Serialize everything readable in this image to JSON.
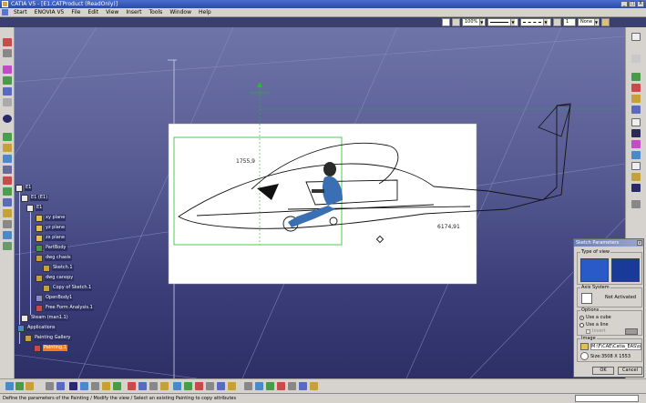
{
  "window": {
    "title": "CATIA V5 - [E1.CATProduct (ReadOnly)]",
    "controls": [
      "_",
      "□",
      "X"
    ]
  },
  "menu": [
    "Start",
    "ENOVIA V5",
    "File",
    "Edit",
    "View",
    "Insert",
    "Tools",
    "Window",
    "Help"
  ],
  "toolbar": {
    "zoom_value": "100%",
    "line_type_value": "",
    "line_weight_value": "",
    "layer_value": "1",
    "none_value": "None"
  },
  "dimensions": [
    "1755,9",
    "6174,91"
  ],
  "tree": {
    "nodes": [
      {
        "label": "E1",
        "selected": false
      },
      {
        "label": "E1 (E1)",
        "selected": false
      },
      {
        "label": "E1",
        "selected": false
      },
      {
        "label": "xy plane",
        "selected": false
      },
      {
        "label": "yz plane",
        "selected": false
      },
      {
        "label": "zx plane",
        "selected": false
      },
      {
        "label": "PartBody",
        "selected": false
      },
      {
        "label": "dwg chasis",
        "selected": false
      },
      {
        "label": "Sketch.1",
        "selected": false
      },
      {
        "label": "dwg canopy",
        "selected": false
      },
      {
        "label": "Copy of Sketch.1",
        "selected": false
      },
      {
        "label": "OpenBody1",
        "selected": false
      },
      {
        "label": "Free Form Analysis.1",
        "selected": false
      },
      {
        "label": "Steam (man1.1)",
        "selected": false
      },
      {
        "label": "Applications",
        "selected": false
      },
      {
        "label": "Painting Gallery",
        "selected": false
      },
      {
        "label": "Painting.1",
        "selected": true
      }
    ]
  },
  "dialog": {
    "title": "Sketch Parameters",
    "close": "x",
    "type_of_view_label": "Type of view",
    "axis_system_label": "Axis System",
    "axis_status": "Not Activated",
    "options_label": "Options",
    "use_cube": "Use a cube",
    "use_line": "Use a line",
    "invert_label": "Invert",
    "image_label": "Image",
    "image_path": "M:\\F\\CAE\\Catia_EAS\\other",
    "image_size": "Size:3508 X 1553",
    "ok": "OK",
    "cancel": "Cancel"
  },
  "status": {
    "text": "Define the parameters of the Painting / Modify the view / Select an existing Painting to copy attributes"
  },
  "colors": {
    "selection": "#ff7a10",
    "sketch_green": "#22c022"
  }
}
